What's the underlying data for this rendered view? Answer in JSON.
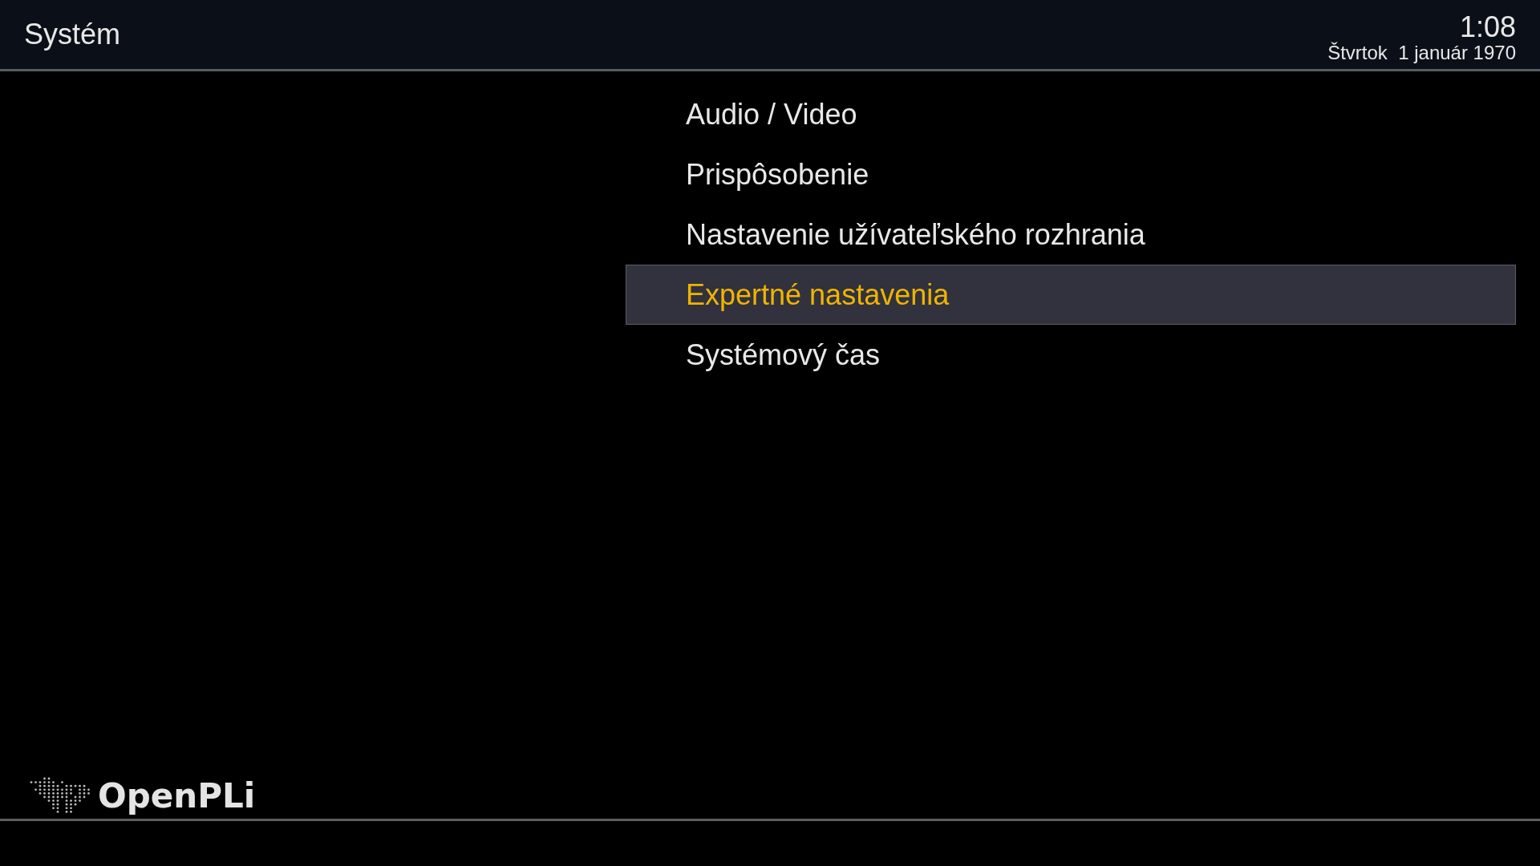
{
  "header": {
    "title": "Systém",
    "time": "1:08",
    "date": "Štvrtok  1 január 1970"
  },
  "menu": [
    {
      "label": "Audio / Video",
      "selected": false
    },
    {
      "label": "Prispôsobenie",
      "selected": false
    },
    {
      "label": "Nastavenie užívateľského rozhrania",
      "selected": false
    },
    {
      "label": "Expertné nastavenia",
      "selected": true
    },
    {
      "label": "Systémový čas",
      "selected": false
    }
  ],
  "logo": {
    "text": "OpenPLi"
  }
}
